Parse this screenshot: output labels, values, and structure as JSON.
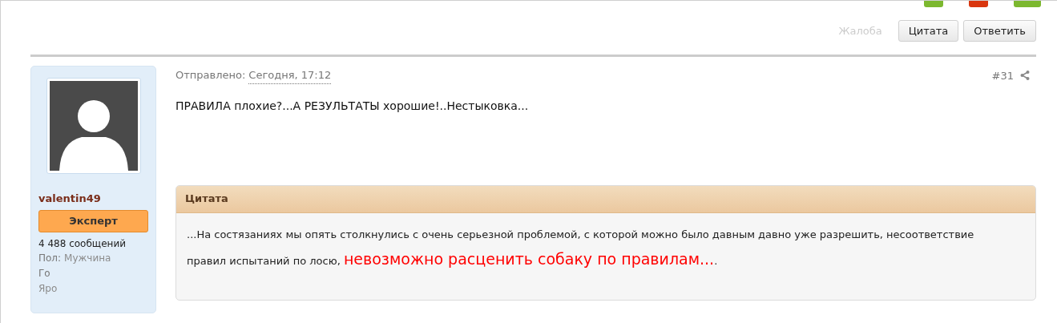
{
  "top_tabs": [
    {
      "color": "#7cb82f"
    },
    {
      "color": "#d9360e"
    },
    {
      "color": "#7cb82f"
    }
  ],
  "actions": {
    "report": "Жалоба",
    "buttons": [
      "Цитата",
      "Ответить"
    ]
  },
  "post": {
    "author": {
      "name": "valentin49",
      "rank": "Эксперт",
      "messages": "4 488 сообщений",
      "fields": [
        {
          "label": "Пол:",
          "value": "Мужчина"
        },
        {
          "label": "Го"
        },
        {
          "value": "Яро"
        }
      ]
    },
    "sent_label": "Отправлено:",
    "sent_time": "Сегодня, 17:12",
    "number": "#31",
    "text": "ПРАВИЛА плохие?...А РЕЗУЛЬТАТЫ хорошие!..Нестыковка...",
    "quote": {
      "title": "Цитата",
      "parts": [
        {
          "kind": "normal",
          "text": "...На состязаниях мы опять столкнулись с очень серьезной  проблемой, с которой можно было давным давно уже разрешить, несоответствие правил испытаний по лосю, "
        },
        {
          "kind": "highlight",
          "text": "невозможно расценить собаку по правилам..."
        },
        {
          "kind": "normal",
          "text": "."
        }
      ]
    }
  }
}
